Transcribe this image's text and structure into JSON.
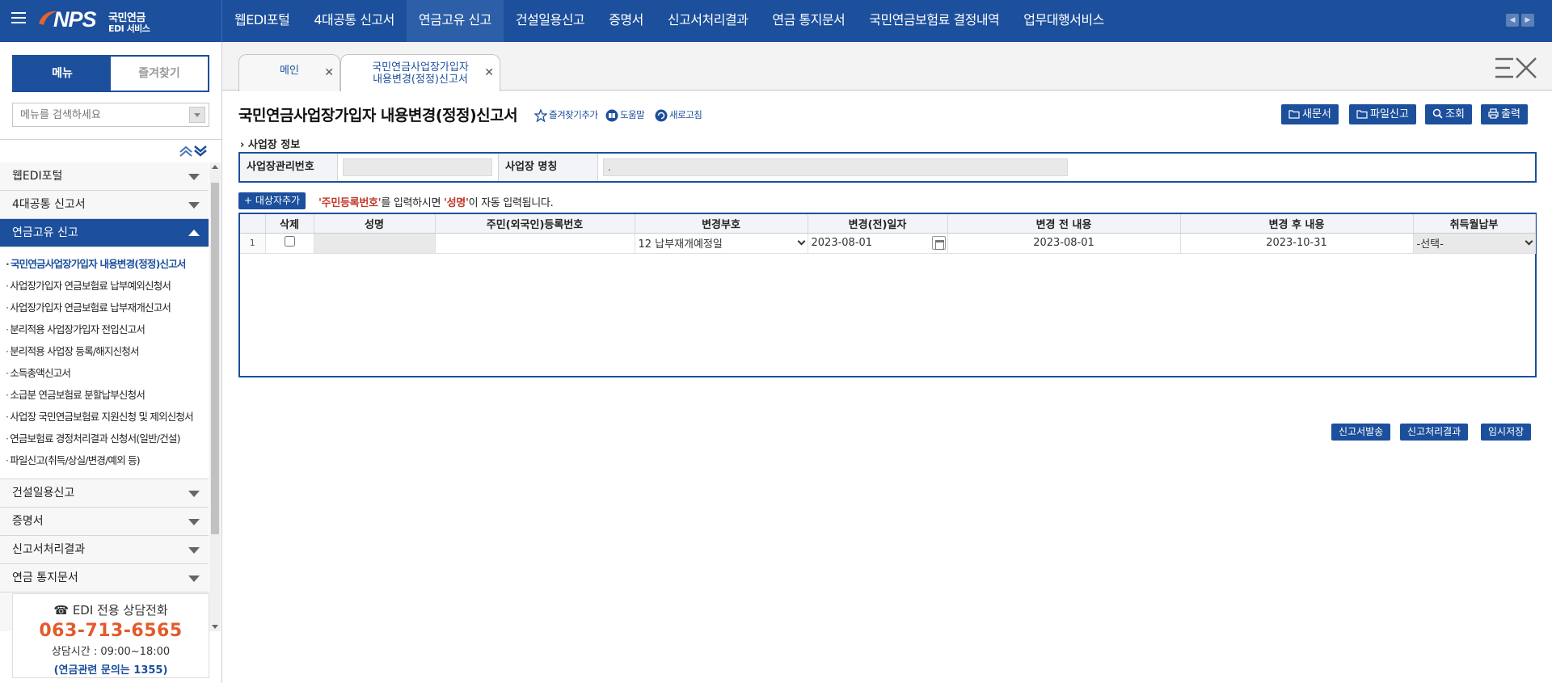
{
  "brand": {
    "logo_text": "NPS",
    "subtitle_line1": "국민연금",
    "subtitle_line2": "EDI 서비스"
  },
  "top_nav": [
    {
      "label": "웹EDI포털",
      "active": false
    },
    {
      "label": "4대공통 신고서",
      "active": false
    },
    {
      "label": "연금고유 신고",
      "active": true
    },
    {
      "label": "건설일용신고",
      "active": false
    },
    {
      "label": "증명서",
      "active": false
    },
    {
      "label": "신고서처리결과",
      "active": false
    },
    {
      "label": "연금 통지문서",
      "active": false
    },
    {
      "label": "국민연금보험료 결정내역",
      "active": false
    },
    {
      "label": "업무대행서비스",
      "active": false
    }
  ],
  "sidebar": {
    "tab_menu": "메뉴",
    "tab_favorites": "즐겨찾기",
    "search_placeholder": "메뉴를 검색하세요",
    "categories_before": [
      {
        "label": "웹EDI포털"
      },
      {
        "label": "4대공통 신고서"
      }
    ],
    "active_category": "연금고유 신고",
    "sub_items": [
      {
        "label": "국민연금사업장가입자 내용변경(정정)신고서",
        "active": true
      },
      {
        "label": "사업장가입자 연금보험료 납부예외신청서",
        "active": false
      },
      {
        "label": "사업장가입자 연금보험료 납부재개신고서",
        "active": false
      },
      {
        "label": "분리적용 사업장가입자 전입신고서",
        "active": false
      },
      {
        "label": "분리적용 사업장 등록/해지신청서",
        "active": false
      },
      {
        "label": "소득총액신고서",
        "active": false
      },
      {
        "label": "소급분 연금보험료 분할납부신청서",
        "active": false
      },
      {
        "label": "사업장 국민연금보험료 지원신청 및 제외신청서",
        "active": false
      },
      {
        "label": "연금보험료 경정처리결과 신청서(일반/건설)",
        "active": false
      },
      {
        "label": "파일신고(취득/상실/변경/예외 등)",
        "active": false
      }
    ],
    "categories_after": [
      {
        "label": "건설일용신고"
      },
      {
        "label": "증명서"
      },
      {
        "label": "신고서처리결과"
      },
      {
        "label": "연금 통지문서"
      }
    ],
    "helpdesk": {
      "title": "☎ EDI 전용 상담전화",
      "phone": "063-713-6565",
      "hours": "상담시간 : 09:00~18:00",
      "note": "(연금관련 문의는 1355)"
    }
  },
  "doc_tabs": [
    {
      "label_line1": "메인",
      "label_line2": "",
      "active": false
    },
    {
      "label_line1": "국민연금사업장가입자",
      "label_line2": "내용변경(정정)신고서",
      "active": true
    }
  ],
  "page": {
    "title": "국민연금사업장가입자 내용변경(정정)신고서",
    "tool_favorite": "즐겨찾기추가",
    "tool_help": "도움말",
    "tool_refresh": "새로고침",
    "btn_new_doc": "새문서",
    "btn_file_report": "파일신고",
    "btn_search": "조회",
    "btn_print": "출력"
  },
  "workplace": {
    "section_label": "사업장 정보",
    "mgmt_no_label": "사업장관리번호",
    "mgmt_no_value": "",
    "name_label": "사업장 명칭",
    "name_value": "."
  },
  "target": {
    "add_button": "+ 대상자추가",
    "hint_part1": "'주민등록번호'",
    "hint_part2": "를 입력하시면 ",
    "hint_part3": "'성명'",
    "hint_part4": "이 자동 입력됩니다."
  },
  "grid": {
    "headers": [
      "",
      "삭제",
      "성명",
      "주민(외국인)등록번호",
      "변경부호",
      "변경(전)일자",
      "변경 전 내용",
      "변경 후 내용",
      "취득월납부"
    ],
    "rows": [
      {
        "row_no": "1",
        "delete_checked": false,
        "name": "",
        "reg_no": "",
        "change_code": "12 납부재개예정일",
        "change_date": "2023-08-01",
        "before": "2023-08-01",
        "after": "2023-10-31",
        "acq_month_pay": "-선택-"
      }
    ]
  },
  "bottom_buttons": {
    "submit": "신고서발송",
    "result": "신고처리결과",
    "temp_save": "임시저장"
  },
  "colors": {
    "primary": "#1c4f9c",
    "phone": "#e25b2b",
    "highlight": "#c0392b"
  }
}
